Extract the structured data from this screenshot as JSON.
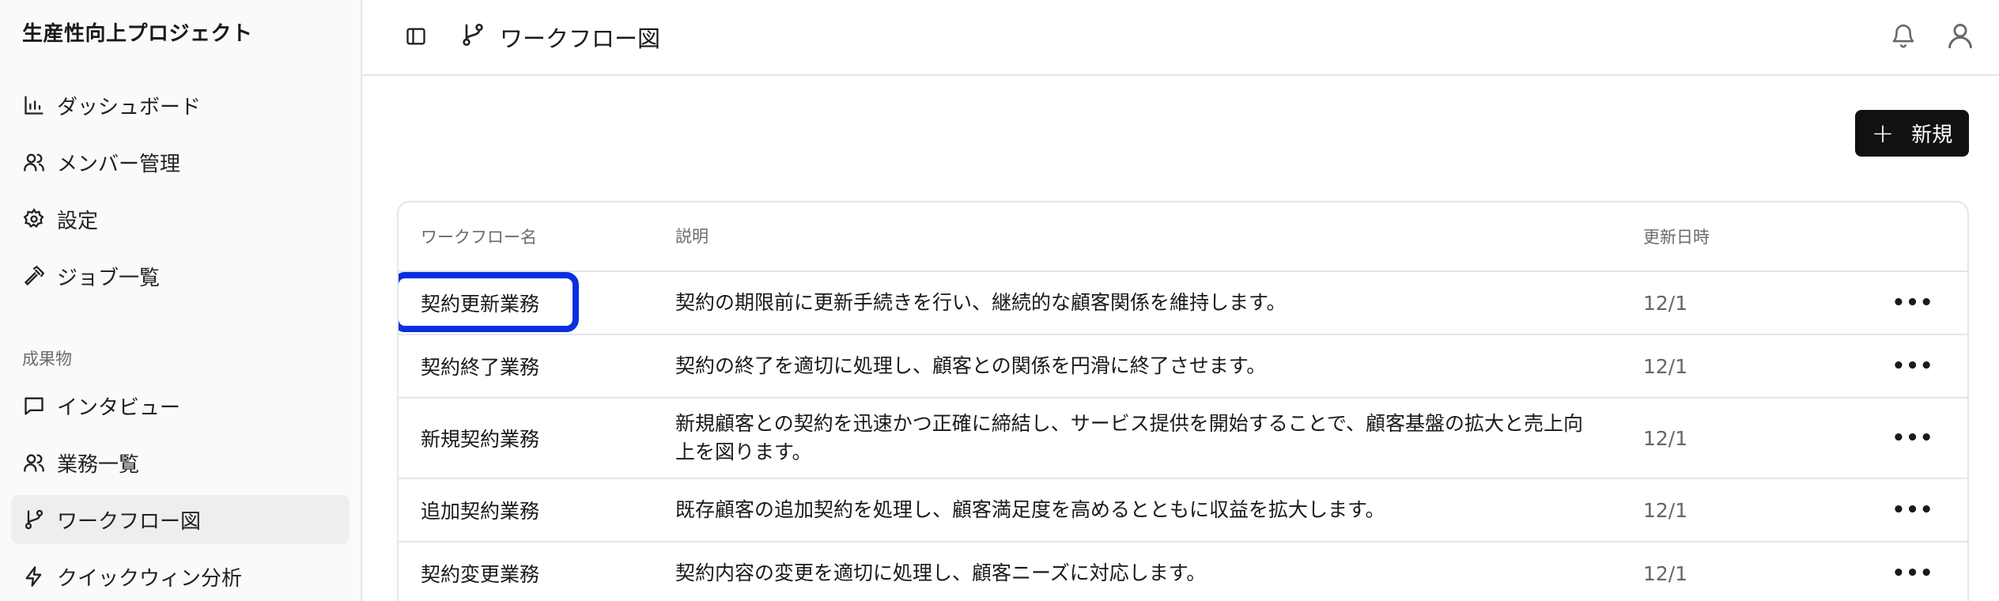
{
  "sidebar": {
    "project_title": "生産性向上プロジェクト",
    "main_items": [
      {
        "label": "ダッシュボード",
        "icon": "bar-chart-icon"
      },
      {
        "label": "メンバー管理",
        "icon": "users-icon"
      },
      {
        "label": "設定",
        "icon": "gear-icon"
      },
      {
        "label": "ジョブ一覧",
        "icon": "hammer-icon"
      }
    ],
    "section_label": "成果物",
    "artifact_items": [
      {
        "label": "インタビュー",
        "icon": "message-icon"
      },
      {
        "label": "業務一覧",
        "icon": "users-icon"
      },
      {
        "label": "ワークフロー図",
        "icon": "git-branch-icon",
        "active": true
      },
      {
        "label": "クイックウィン分析",
        "icon": "lightning-icon"
      }
    ]
  },
  "header": {
    "title": "ワークフロー図"
  },
  "toolbar": {
    "new_label": "新規",
    "new_icon": "plus"
  },
  "table": {
    "columns": [
      "ワークフロー名",
      "説明",
      "更新日時"
    ],
    "rows": [
      {
        "name": "契約更新業務",
        "description": "契約の期限前に更新手続きを行い、継続的な顧客関係を維持します。",
        "updated": "12/1"
      },
      {
        "name": "契約終了業務",
        "description": "契約の終了を適切に処理し、顧客との関係を円滑に終了させます。",
        "updated": "12/1"
      },
      {
        "name": "新規契約業務",
        "description": "新規顧客との契約を迅速かつ正確に締結し、サービス提供を開始することで、顧客基盤の拡大と売上向上を図ります。",
        "updated": "12/1"
      },
      {
        "name": "追加契約業務",
        "description": "既存顧客の追加契約を処理し、顧客満足度を高めるとともに収益を拡大します。",
        "updated": "12/1"
      },
      {
        "name": "契約変更業務",
        "description": "契約内容の変更を適切に処理し、顧客ニーズに対応します。",
        "updated": "12/1"
      }
    ],
    "row_menu": "•••"
  },
  "colors": {
    "highlight": "#0a2fe0",
    "primary_button": "#111111"
  }
}
